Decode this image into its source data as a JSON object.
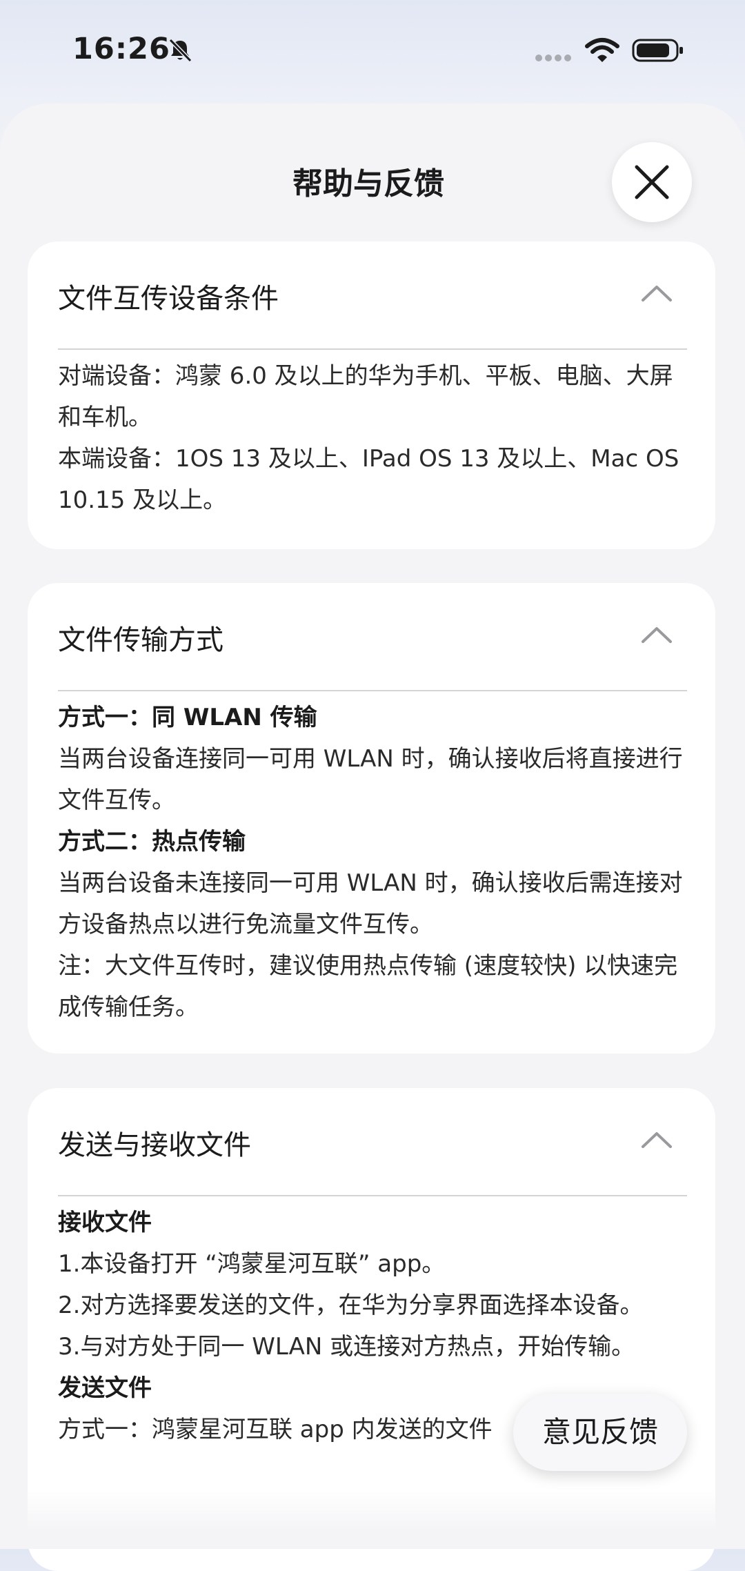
{
  "status_bar": {
    "time": "16:26",
    "icons": [
      "bell-muted-icon",
      "signal-dots-icon",
      "wifi-icon",
      "battery-icon"
    ]
  },
  "sheet": {
    "title": "帮助与反馈",
    "close_icon": "close-icon"
  },
  "cards": [
    {
      "title": "文件互传设备条件",
      "paragraphs": [
        "对端设备：鸿蒙 6.0 及以上的华为手机、平板、电脑、大屏和车机。",
        "本端设备：1OS 13 及以上、IPad OS 13 及以上、Mac OS 10.15 及以上。"
      ]
    },
    {
      "title": "文件传输方式",
      "paragraphs": [
        "方式一：同 WLAN 传输",
        "当两台设备连接同一可用 WLAN 时，确认接收后将直接进行文件互传。",
        "方式二：热点传输",
        "当两台设备未连接同一可用 WLAN 时，确认接收后需连接对方设备热点以进行免流量文件互传。",
        "注：大文件互传时，建议使用热点传输 (速度较快) 以快速完成传输任务。"
      ]
    },
    {
      "title": "发送与接收文件",
      "paragraphs": [
        "接收文件",
        "1.本设备打开 “鸿蒙星河互联” app。",
        "2.对方选择要发送的文件，在华为分享界面选择本设备。",
        "3.与对方处于同一 WLAN 或连接对方热点，开始传输。",
        "发送文件",
        "方式一：鸿蒙星河互联 app 内发送的文件"
      ]
    }
  ],
  "feedback_button": "意见反馈",
  "colors": {
    "sheet_bg": "#f4f4f6",
    "card_bg": "#ffffff",
    "text": "#1b1b1b"
  }
}
